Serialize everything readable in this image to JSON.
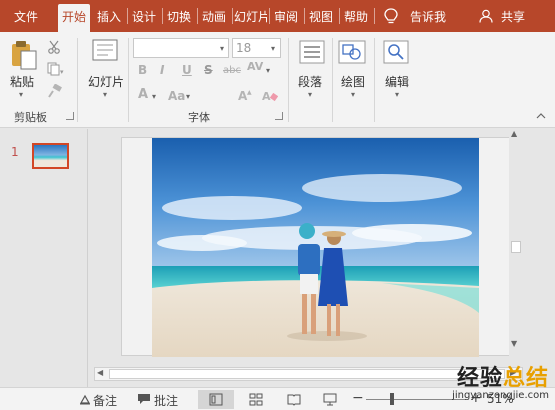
{
  "tabs": [
    "文件",
    "开始",
    "插入",
    "设计",
    "切换",
    "动画",
    "幻灯片",
    "审阅",
    "视图",
    "帮助"
  ],
  "active_tab": "开始",
  "tell_me": "告诉我",
  "share": "共享",
  "clipboard": {
    "paste": "粘贴",
    "group": "剪贴板"
  },
  "slides": {
    "label": "幻灯片"
  },
  "font": {
    "name_value": "",
    "size_value": "18",
    "group": "字体",
    "bold": "B",
    "italic": "I",
    "underline": "U",
    "strike": "S",
    "abc": "abc",
    "spacing": "AV",
    "color_a": "A",
    "case": "Aa"
  },
  "paragraph": {
    "label": "段落"
  },
  "drawing": {
    "label": "绘图"
  },
  "editing": {
    "label": "编辑"
  },
  "thumbnail": {
    "number": "1"
  },
  "status": {
    "notes": "备注",
    "comments": "批注",
    "zoom": "51%"
  },
  "watermark": {
    "brand_a": "经验",
    "brand_b": "总结",
    "url": "jingyanzongjie.com"
  }
}
